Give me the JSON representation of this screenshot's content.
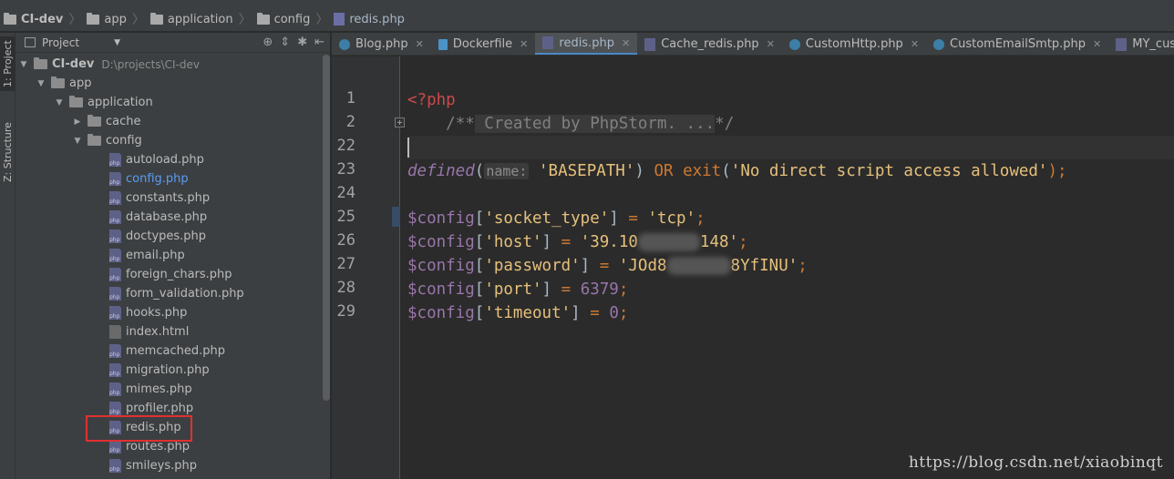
{
  "navbar": {
    "crumbs": [
      {
        "label": "CI-dev",
        "type": "folder"
      },
      {
        "label": "app",
        "type": "folder"
      },
      {
        "label": "application",
        "type": "folder"
      },
      {
        "label": "config",
        "type": "folder"
      },
      {
        "label": "redis.php",
        "type": "php"
      }
    ]
  },
  "toolstripe": {
    "project_tab": "1: Project",
    "structure_tab": "Z: Structure"
  },
  "project_panel": {
    "title": "Project",
    "tree": [
      {
        "label": "CI-dev",
        "path": "D:\\projects\\CI-dev",
        "type": "folder",
        "depth": 0,
        "expanded": true
      },
      {
        "label": "app",
        "type": "folder",
        "depth": 1,
        "expanded": true
      },
      {
        "label": "application",
        "type": "folder",
        "depth": 2,
        "expanded": true
      },
      {
        "label": "cache",
        "type": "folder",
        "depth": 3,
        "expanded": false
      },
      {
        "label": "config",
        "type": "folder",
        "depth": 3,
        "expanded": true
      },
      {
        "label": "autoload.php",
        "type": "php",
        "depth": 4
      },
      {
        "label": "config.php",
        "type": "php",
        "depth": 4,
        "modified": true
      },
      {
        "label": "constants.php",
        "type": "php",
        "depth": 4
      },
      {
        "label": "database.php",
        "type": "php",
        "depth": 4
      },
      {
        "label": "doctypes.php",
        "type": "php",
        "depth": 4
      },
      {
        "label": "email.php",
        "type": "php",
        "depth": 4
      },
      {
        "label": "foreign_chars.php",
        "type": "php",
        "depth": 4
      },
      {
        "label": "form_validation.php",
        "type": "php",
        "depth": 4
      },
      {
        "label": "hooks.php",
        "type": "php",
        "depth": 4
      },
      {
        "label": "index.html",
        "type": "html",
        "depth": 4
      },
      {
        "label": "memcached.php",
        "type": "php",
        "depth": 4
      },
      {
        "label": "migration.php",
        "type": "php",
        "depth": 4
      },
      {
        "label": "mimes.php",
        "type": "php",
        "depth": 4
      },
      {
        "label": "profiler.php",
        "type": "php",
        "depth": 4
      },
      {
        "label": "redis.php",
        "type": "php",
        "depth": 4,
        "highlighted": true
      },
      {
        "label": "routes.php",
        "type": "php",
        "depth": 4
      },
      {
        "label": "smileys.php",
        "type": "php",
        "depth": 4
      }
    ]
  },
  "tabs": [
    {
      "label": "Blog.php",
      "icon": "class",
      "active": false
    },
    {
      "label": "Dockerfile",
      "icon": "docker",
      "active": false
    },
    {
      "label": "redis.php",
      "icon": "php",
      "active": true
    },
    {
      "label": "Cache_redis.php",
      "icon": "php",
      "active": false
    },
    {
      "label": "CustomHttp.php",
      "icon": "class",
      "active": false
    },
    {
      "label": "CustomEmailSmtp.php",
      "icon": "class",
      "active": false
    },
    {
      "label": "MY_custom_functio",
      "icon": "php",
      "active": false
    }
  ],
  "editor": {
    "line_numbers": [
      "1",
      "2",
      "22",
      "23",
      "24",
      "25",
      "26",
      "27",
      "28",
      "29"
    ],
    "lines": {
      "l1": "<?php",
      "l2_open": "/**",
      "l2_fold": " Created by PhpStorm. ...",
      "l2_close": "*/",
      "l23_fn": "defined",
      "l23_hint": "name:",
      "l23_arg": "'BASEPATH'",
      "l23_or": "OR",
      "l23_exit": "exit",
      "l23_msg": "'No direct script access allowed'",
      "l25_var": "$config",
      "l25_key": "'socket_type'",
      "l25_val": "'tcp'",
      "l26_var": "$config",
      "l26_key": "'host'",
      "l26_val_a": "'39.10",
      "l26_val_b": "148'",
      "l27_var": "$config",
      "l27_key": "'password'",
      "l27_val_a": "'JOd8",
      "l27_val_b": "8YfINU'",
      "l28_var": "$config",
      "l28_key": "'port'",
      "l28_val": "6379",
      "l29_var": "$config",
      "l29_key": "'timeout'",
      "l29_val": "0"
    }
  },
  "watermark": "https://blog.csdn.net/xiaobinqt"
}
